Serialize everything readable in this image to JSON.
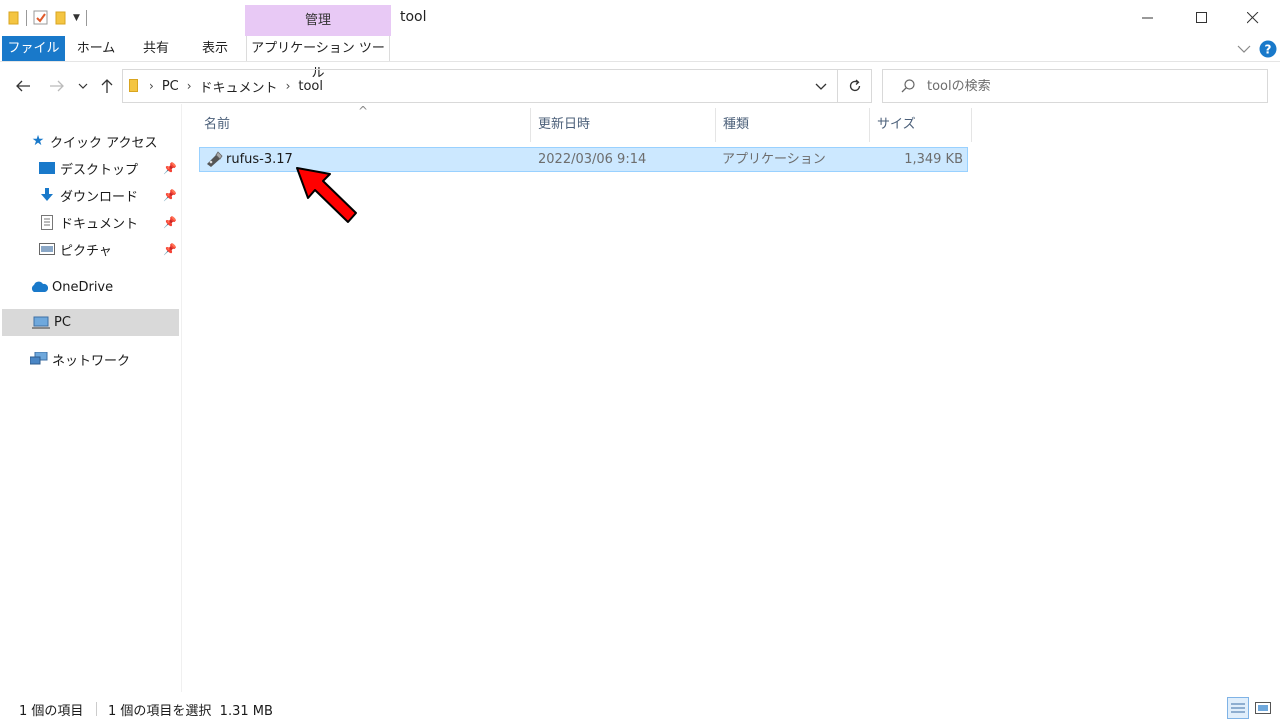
{
  "window": {
    "title": "tool",
    "manage_tab": "管理",
    "minimize": "—",
    "maximize": "☐",
    "close": "✕"
  },
  "ribbon": {
    "tabs": [
      "ファイル",
      "ホーム",
      "共有",
      "表示",
      "アプリケーション ツール"
    ]
  },
  "address": {
    "crumbs": [
      "PC",
      "ドキュメント",
      "tool"
    ],
    "search_placeholder": "toolの検索"
  },
  "navpane": {
    "quick_access": "クイック アクセス",
    "items": [
      {
        "label": "デスクトップ",
        "icon": "desktop-icon",
        "pinned": true
      },
      {
        "label": "ダウンロード",
        "icon": "download-icon",
        "pinned": true
      },
      {
        "label": "ドキュメント",
        "icon": "document-icon",
        "pinned": true
      },
      {
        "label": "ピクチャ",
        "icon": "picture-icon",
        "pinned": true
      }
    ],
    "onedrive": "OneDrive",
    "pc": "PC",
    "network": "ネットワーク"
  },
  "columns": {
    "name": "名前",
    "modified": "更新日時",
    "type": "種類",
    "size": "サイズ"
  },
  "files": [
    {
      "name": "rufus-3.17",
      "modified": "2022/03/06 9:14",
      "type": "アプリケーション",
      "size": "1,349 KB",
      "selected": true
    }
  ],
  "status": {
    "count": "1 個の項目",
    "selection": "1 個の項目を選択  1.31 MB"
  },
  "colors": {
    "file_tab": "#1979ca",
    "manage_tab": "#e8c9f5",
    "selection": "#cce8ff",
    "arrow": "#ff0000"
  }
}
